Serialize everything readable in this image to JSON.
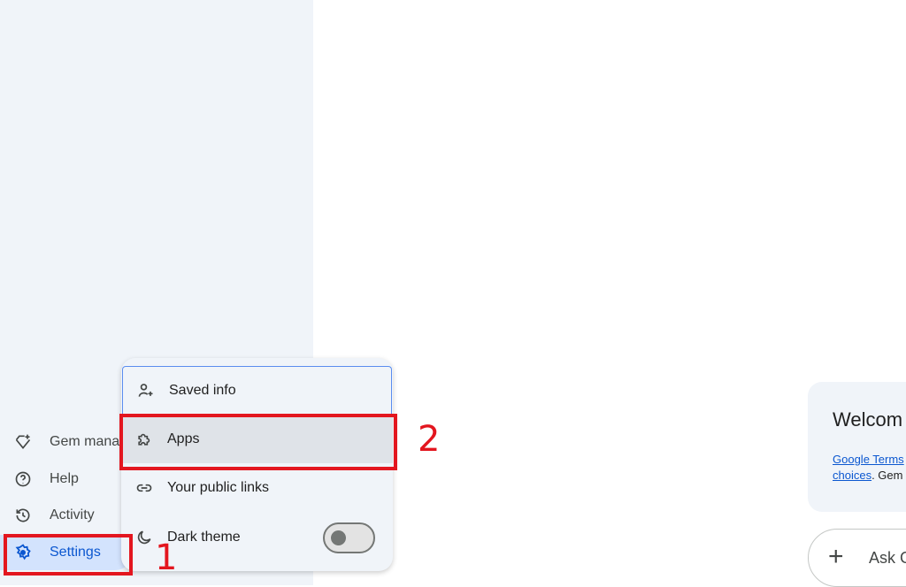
{
  "sidebar": {
    "items": [
      {
        "label": "Gem mana",
        "icon": "gem-sparkle-icon"
      },
      {
        "label": "Help",
        "icon": "help-circle-icon"
      },
      {
        "label": "Activity",
        "icon": "history-icon"
      },
      {
        "label": "Settings",
        "icon": "gear-icon",
        "active": true
      }
    ]
  },
  "settings_menu": {
    "items": [
      {
        "label": "Saved info",
        "icon": "person-sparkle-icon"
      },
      {
        "label": "Apps",
        "icon": "puzzle-icon"
      },
      {
        "label": "Your public links",
        "icon": "link-icon"
      },
      {
        "label": "Dark theme",
        "icon": "moon-icon",
        "toggle": false
      }
    ]
  },
  "annotations": {
    "step1": "1",
    "step2": "2",
    "color": "#e3161f"
  },
  "welcome": {
    "title": "Welcom",
    "link1": "Google Terms",
    "link2": "choices",
    "text2": ". Gem"
  },
  "prompt": {
    "placeholder": "Ask G",
    "plus": "+"
  },
  "colors": {
    "accent": "#0b57d0",
    "sidebar_bg": "#f0f4f9",
    "active_bg": "#d3e3fd"
  }
}
